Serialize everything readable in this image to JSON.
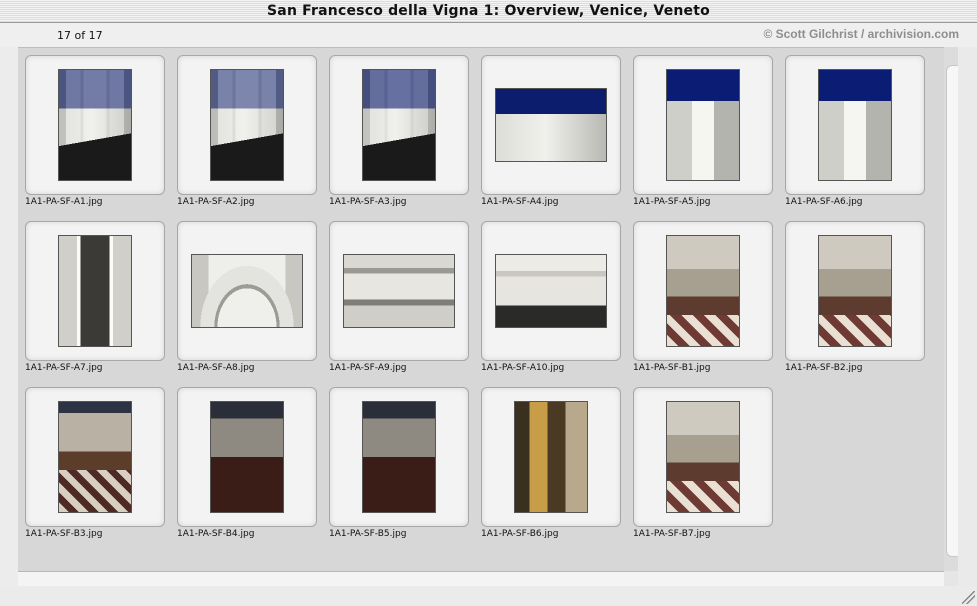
{
  "window": {
    "title": "San Francesco della Vigna 1: Overview, Venice, Veneto",
    "counter": "17 of 17",
    "credit": "© Scott Gilchrist / archivision.com"
  },
  "thumbnails": [
    {
      "caption": "1A1-PA-SF-A1.jpg",
      "kind": "facade-portrait"
    },
    {
      "caption": "1A1-PA-SF-A2.jpg",
      "kind": "facade-portrait"
    },
    {
      "caption": "1A1-PA-SF-A3.jpg",
      "kind": "facade-portrait"
    },
    {
      "caption": "1A1-PA-SF-A4.jpg",
      "kind": "pediment-landscape"
    },
    {
      "caption": "1A1-PA-SF-A5.jpg",
      "kind": "column-portrait"
    },
    {
      "caption": "1A1-PA-SF-A6.jpg",
      "kind": "column-portrait"
    },
    {
      "caption": "1A1-PA-SF-A7.jpg",
      "kind": "niche-portrait"
    },
    {
      "caption": "1A1-PA-SF-A8.jpg",
      "kind": "lunette-landscape"
    },
    {
      "caption": "1A1-PA-SF-A9.jpg",
      "kind": "window-landscape"
    },
    {
      "caption": "1A1-PA-SF-A10.jpg",
      "kind": "inscription-landscape"
    },
    {
      "caption": "1A1-PA-SF-B1.jpg",
      "kind": "interior-portrait"
    },
    {
      "caption": "1A1-PA-SF-B2.jpg",
      "kind": "interior-portrait"
    },
    {
      "caption": "1A1-PA-SF-B3.jpg",
      "kind": "interior-portrait"
    },
    {
      "caption": "1A1-PA-SF-B4.jpg",
      "kind": "interior-portrait"
    },
    {
      "caption": "1A1-PA-SF-B5.jpg",
      "kind": "interior-portrait"
    },
    {
      "caption": "1A1-PA-SF-B6.jpg",
      "kind": "altar-portrait"
    },
    {
      "caption": "1A1-PA-SF-B7.jpg",
      "kind": "interior-portrait"
    }
  ],
  "colors": {
    "window_bg": "#e6e6e6",
    "grid_bg": "#d7d7d7",
    "frame_bg": "#f3f3f3",
    "credit_text": "#8e8e8e"
  }
}
